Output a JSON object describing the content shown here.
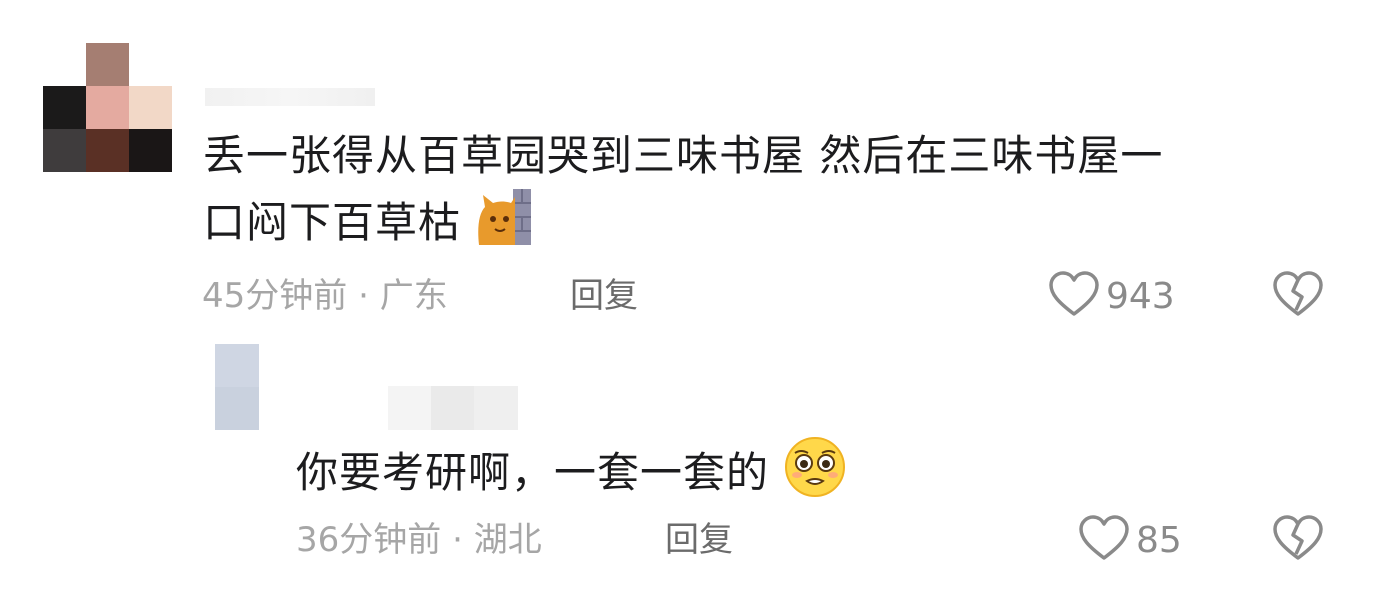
{
  "comments": [
    {
      "text_line1": "丢一张得从百草园哭到三味书屋 然后在三味书屋一",
      "text_line2": "口闷下百草枯",
      "emoji": "cat-peeking-emoji",
      "time": "45分钟前",
      "separator": "·",
      "location": "广东",
      "reply_label": "回复",
      "likes": "943",
      "avatar_colors": [
        "#ffffff",
        "#a57e72",
        "#ffffff",
        "#1b1a1a",
        "#e4aaa0",
        "#f2d8c7",
        "#3f3c3d",
        "#5a3025",
        "#1a1616"
      ]
    },
    {
      "text": "你要考研啊，一套一套的",
      "emoji": "pleading-face-emoji",
      "time": "36分钟前",
      "separator": "·",
      "location": "湖北",
      "reply_label": "回复",
      "likes": "85",
      "avatar_colors": [
        "#cfd6e3",
        "#c9d1de"
      ]
    }
  ],
  "icons": {
    "like": "heart-outline-icon",
    "dislike": "broken-heart-outline-icon"
  },
  "colors": {
    "text": "#1c1c1e",
    "meta": "#a6a6a6",
    "icon": "#8a8a8a"
  }
}
